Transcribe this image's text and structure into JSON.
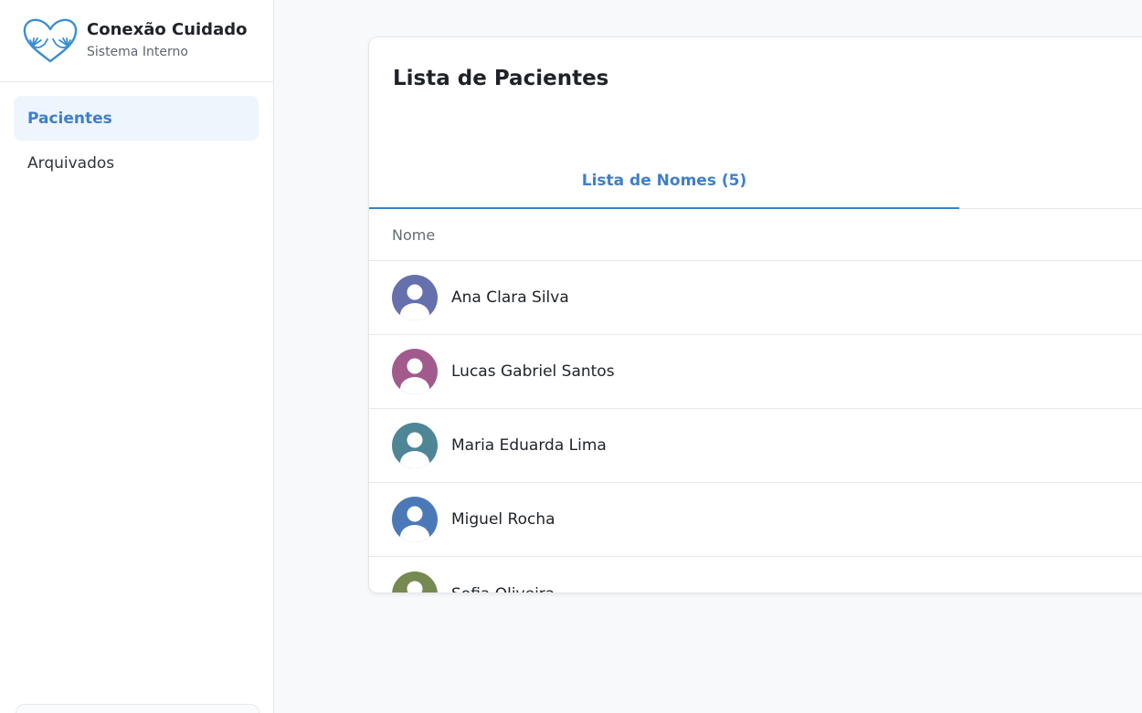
{
  "brand": {
    "title": "Conexão Cuidado",
    "subtitle": "Sistema Interno",
    "logo_icon": "heart-hands-icon",
    "logo_color": "#3a8fd4"
  },
  "sidebar": {
    "items": [
      {
        "label": "Pacientes",
        "active": true
      },
      {
        "label": "Arquivados",
        "active": false
      }
    ]
  },
  "main": {
    "title": "Lista de Pacientes",
    "tabs": [
      {
        "label": "Lista de Nomes (5)",
        "active": true
      }
    ],
    "column_header": "Nome",
    "patients": [
      {
        "name": "Ana Clara Silva",
        "avatar_color": "#6570ad"
      },
      {
        "name": "Lucas Gabriel Santos",
        "avatar_color": "#a25a8d"
      },
      {
        "name": "Maria Eduarda Lima",
        "avatar_color": "#4e8696"
      },
      {
        "name": "Miguel Rocha",
        "avatar_color": "#4b79b8"
      },
      {
        "name": "Sofia Oliveira",
        "avatar_color": "#758950"
      }
    ]
  },
  "colors": {
    "accent": "#3d7fcc",
    "active_bg": "#eef5fd",
    "border": "#e6e8ec"
  }
}
